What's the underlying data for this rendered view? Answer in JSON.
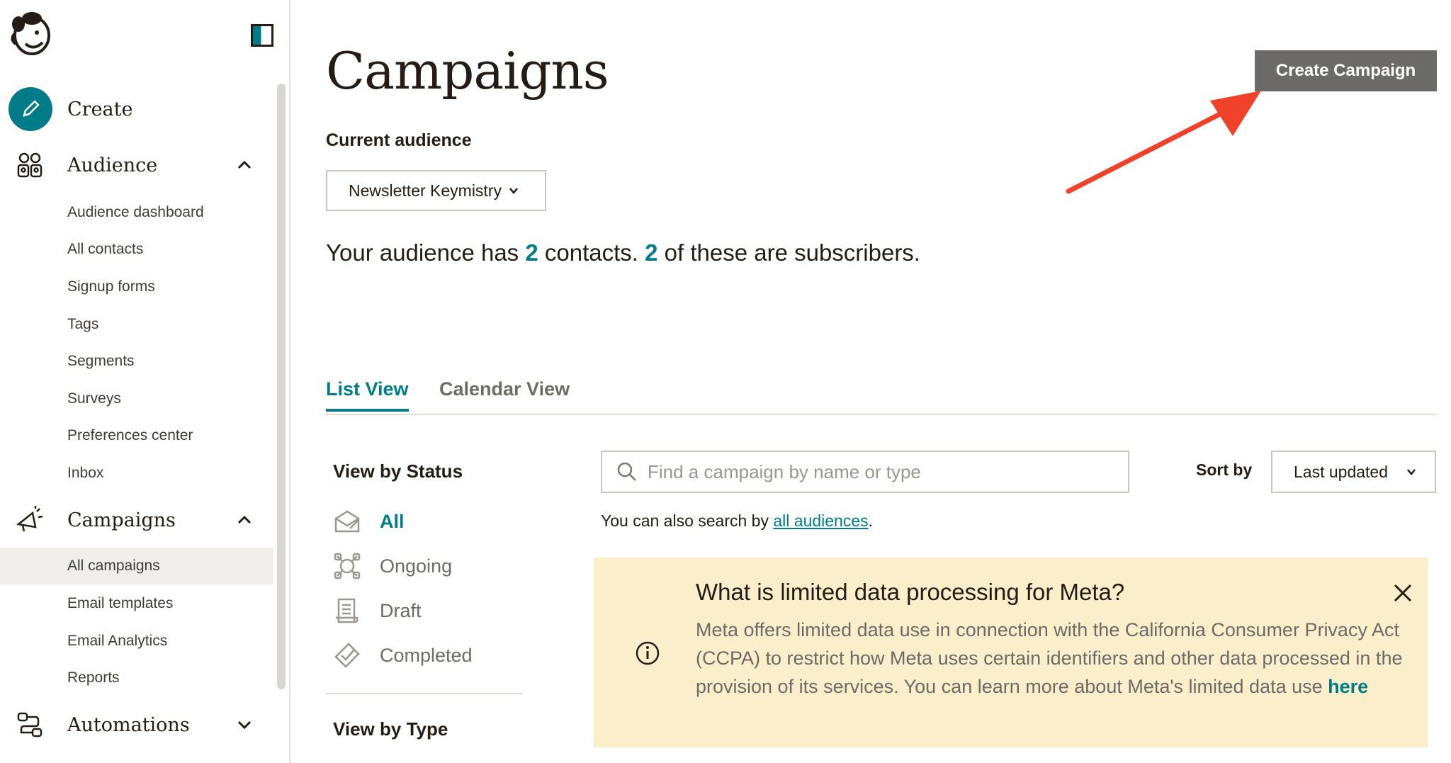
{
  "sidebar": {
    "create_label": "Create",
    "audience": {
      "label": "Audience",
      "items": [
        "Audience dashboard",
        "All contacts",
        "Signup forms",
        "Tags",
        "Segments",
        "Surveys",
        "Preferences center",
        "Inbox"
      ]
    },
    "campaigns": {
      "label": "Campaigns",
      "items": [
        "All campaigns",
        "Email templates",
        "Email Analytics",
        "Reports"
      ],
      "active_item": "All campaigns"
    },
    "automations_label": "Automations"
  },
  "header": {
    "title": "Campaigns",
    "create_button": "Create Campaign"
  },
  "audience": {
    "label": "Current audience",
    "selected": "Newsletter Keymistry",
    "stats": {
      "prefix": "Your audience has ",
      "contacts": "2",
      "middle": " contacts. ",
      "subscribers": "2",
      "suffix": " of these are subscribers."
    }
  },
  "tabs": [
    "List View",
    "Calendar View"
  ],
  "filters": {
    "status_heading": "View by Status",
    "statuses": [
      "All",
      "Ongoing",
      "Draft",
      "Completed"
    ],
    "type_heading": "View by Type"
  },
  "search": {
    "placeholder": "Find a campaign by name or type",
    "note_prefix": "You can also search by ",
    "note_link": "all audiences",
    "note_suffix": "."
  },
  "sort": {
    "label": "Sort by",
    "selected": "Last updated"
  },
  "notice": {
    "title": "What is limited data processing for Meta?",
    "body": "Meta offers limited data use in connection with the California Consumer Privacy Act (CCPA) to restrict how Meta uses certain identifiers and other data processed in the provision of its services. You can learn more about Meta's limited data use ",
    "link": "here"
  },
  "colors": {
    "accent": "#007c89",
    "button": "#6b6a68",
    "notice_bg": "#fbeecb",
    "arrow": "#f0412b"
  }
}
